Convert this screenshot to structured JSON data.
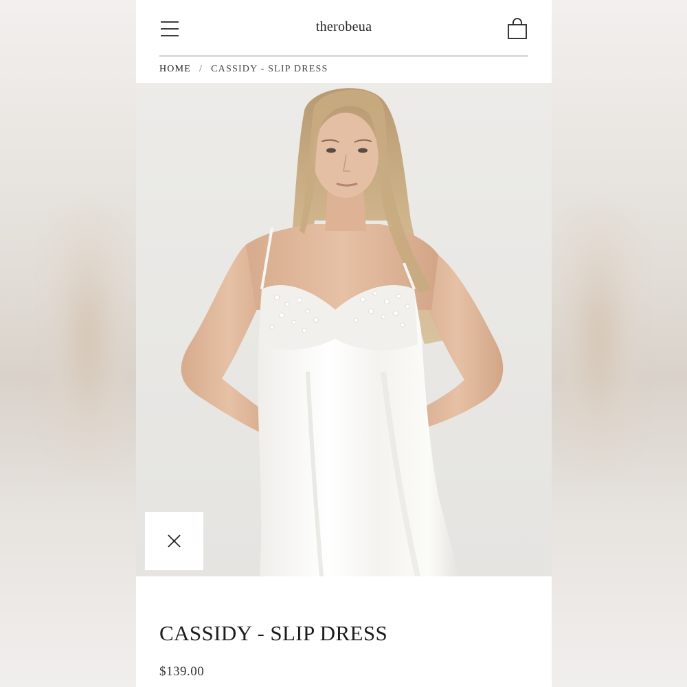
{
  "header": {
    "brand": "therobeua"
  },
  "breadcrumb": {
    "home": "HOME",
    "separator": "/",
    "current": "CASSIDY - SLIP DRESS"
  },
  "product": {
    "title": "CASSIDY - SLIP DRESS",
    "price": "$139.00"
  },
  "icons": {
    "menu": "hamburger-menu-icon",
    "cart": "shopping-bag-icon",
    "close": "close-icon"
  },
  "colors": {
    "page_background": "#ffffff",
    "text": "#1c1c1c",
    "divider": "#7a7a7a",
    "image_background": "#ecebe8"
  }
}
